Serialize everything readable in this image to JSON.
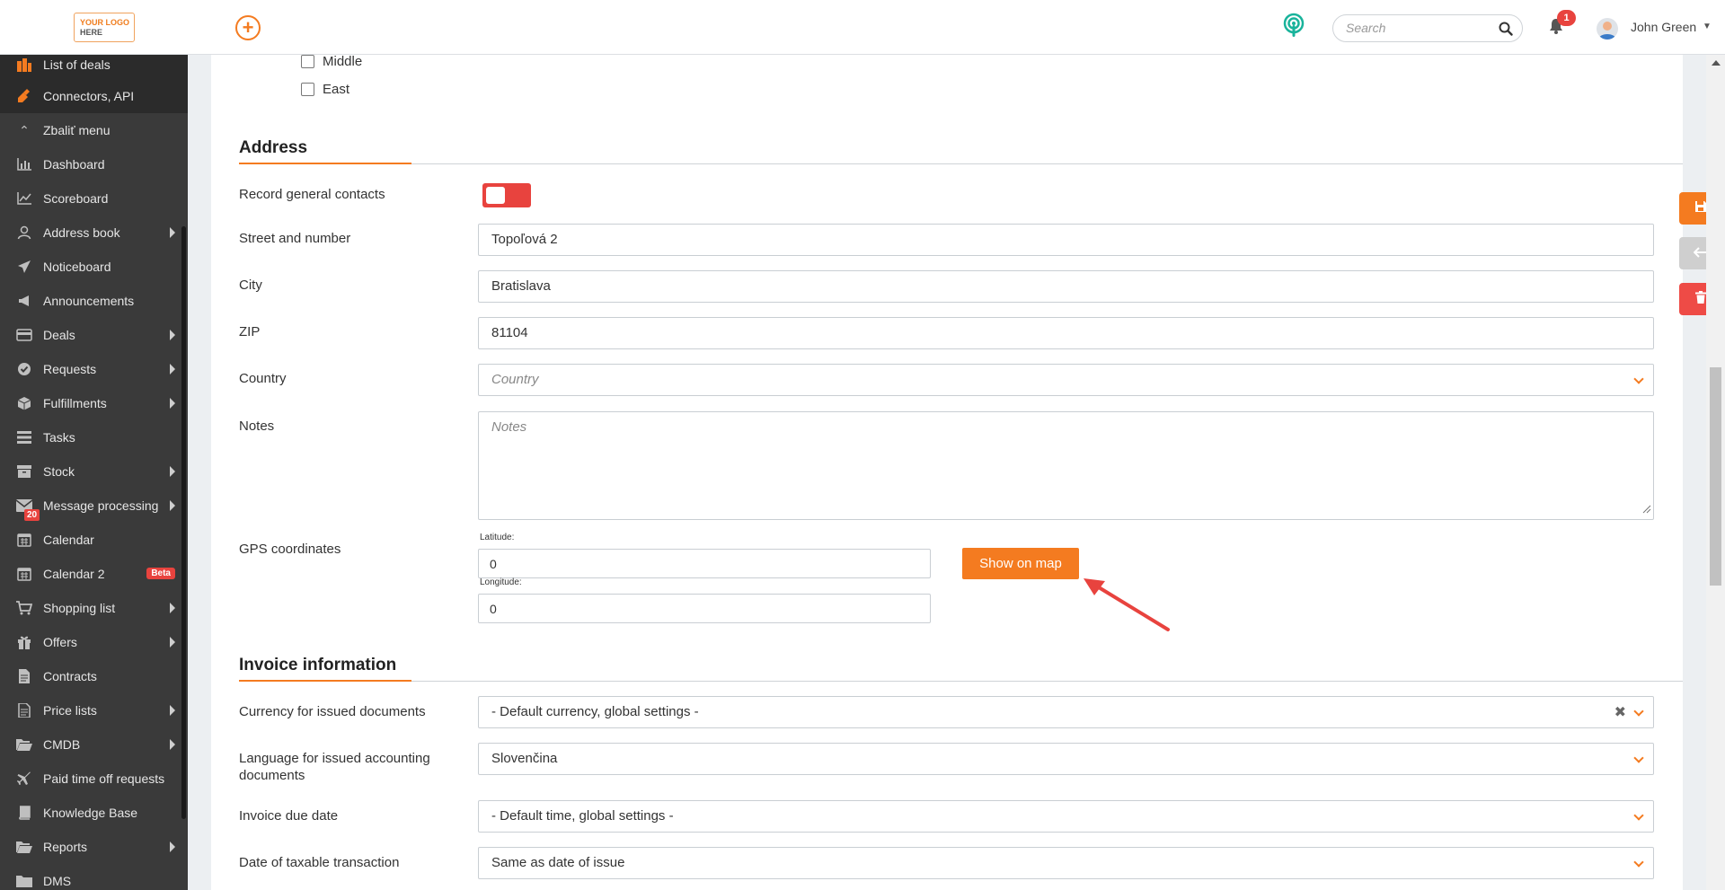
{
  "header": {
    "logo_line1": "YOUR LOGO",
    "logo_line2": "HERE",
    "search_placeholder": "Search",
    "notification_count": "1",
    "user_name": "John Green"
  },
  "sidebar": {
    "items": [
      {
        "label": "List of deals",
        "icon": "deals-list-icon"
      },
      {
        "label": "Connectors, API",
        "icon": "plug-icon"
      },
      {
        "label": "Zbaliť menu",
        "icon": "collapse-icon"
      },
      {
        "label": "Dashboard",
        "icon": "bar-chart-icon"
      },
      {
        "label": "Scoreboard",
        "icon": "line-chart-icon"
      },
      {
        "label": "Address book",
        "icon": "user-icon"
      },
      {
        "label": "Noticeboard",
        "icon": "paper-plane-icon"
      },
      {
        "label": "Announcements",
        "icon": "megaphone-icon"
      },
      {
        "label": "Deals",
        "icon": "credit-card-icon"
      },
      {
        "label": "Requests",
        "icon": "check-circle-icon"
      },
      {
        "label": "Fulfillments",
        "icon": "box-icon"
      },
      {
        "label": "Tasks",
        "icon": "tasks-icon"
      },
      {
        "label": "Stock",
        "icon": "archive-icon"
      },
      {
        "label": "Message processing",
        "icon": "envelope-icon",
        "badge": "20"
      },
      {
        "label": "Calendar",
        "icon": "calendar-icon"
      },
      {
        "label": "Calendar 2",
        "icon": "calendar-icon",
        "tag": "Beta"
      },
      {
        "label": "Shopping list",
        "icon": "cart-icon"
      },
      {
        "label": "Offers",
        "icon": "gift-icon"
      },
      {
        "label": "Contracts",
        "icon": "file-icon"
      },
      {
        "label": "Price lists",
        "icon": "price-list-icon"
      },
      {
        "label": "CMDB",
        "icon": "folder-open-icon"
      },
      {
        "label": "Paid time off requests",
        "icon": "plane-icon"
      },
      {
        "label": "Knowledge Base",
        "icon": "book-icon"
      },
      {
        "label": "Reports",
        "icon": "folder-open-icon"
      },
      {
        "label": "DMS",
        "icon": "folder-icon"
      }
    ]
  },
  "regions": {
    "items": [
      {
        "label": "Middle",
        "checked": false
      },
      {
        "label": "East",
        "checked": false
      }
    ]
  },
  "address": {
    "title": "Address",
    "record_general_contacts_label": "Record general contacts",
    "street_label": "Street and number",
    "street_value": "Topoľová 2",
    "city_label": "City",
    "city_value": "Bratislava",
    "zip_label": "ZIP",
    "zip_value": "81104",
    "country_label": "Country",
    "country_placeholder": "Country",
    "notes_label": "Notes",
    "notes_placeholder": "Notes",
    "gps_label": "GPS coordinates",
    "latitude_label": "Latitude:",
    "latitude_value": "0",
    "longitude_label": "Longitude:",
    "longitude_value": "0",
    "show_on_map_label": "Show on map"
  },
  "invoice": {
    "title": "Invoice information",
    "currency_label": "Currency for issued documents",
    "currency_value": "- Default currency, global settings -",
    "language_label_line1": "Language for issued accounting",
    "language_label_line2": "documents",
    "language_value": "Slovenčina",
    "due_date_label": "Invoice due date",
    "due_date_value": "- Default time, global settings -",
    "taxable_label": "Date of taxable transaction",
    "taxable_value": "Same as date of issue"
  },
  "colors": {
    "accent": "#f47b20",
    "danger": "#e8433e",
    "sidebar_bg": "#3a3a3a",
    "annotation_arrow": "#e8433e"
  }
}
